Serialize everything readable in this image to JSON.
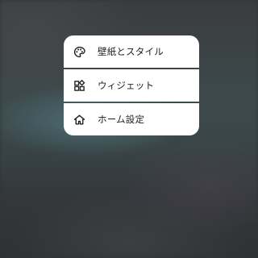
{
  "menu": {
    "items": [
      {
        "label": "壁紙とスタイル",
        "icon": "palette-icon"
      },
      {
        "label": "ウィジェット",
        "icon": "widgets-icon"
      },
      {
        "label": "ホーム設定",
        "icon": "home-icon"
      }
    ]
  },
  "colors": {
    "menu_background": "#ffffff",
    "text": "#202124",
    "icon": "#202124"
  }
}
